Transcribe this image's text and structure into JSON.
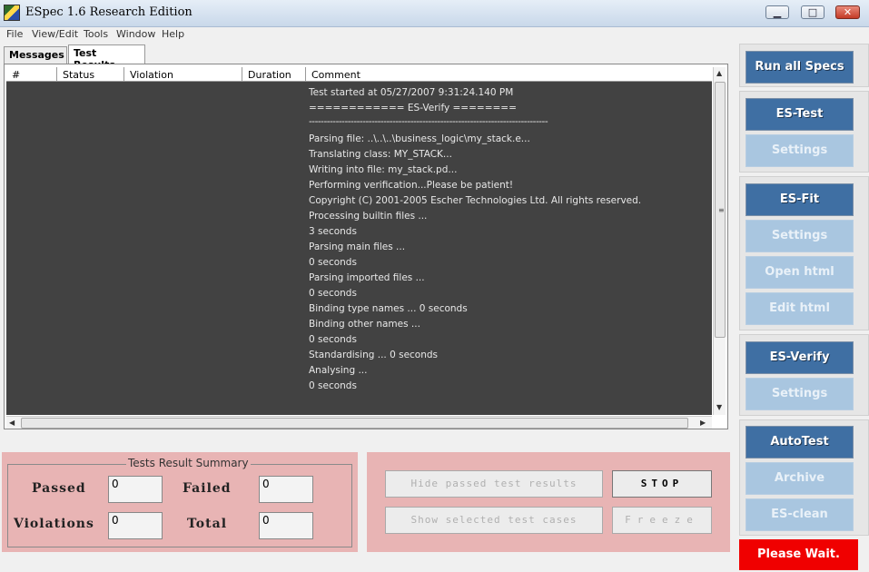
{
  "window": {
    "title": "ESpec 1.6 Research Edition"
  },
  "menu": [
    "File",
    "View/Edit",
    "Tools",
    "Window",
    "Help"
  ],
  "tabs": [
    "Messages",
    "Test Results"
  ],
  "table": {
    "columns": [
      "#",
      "Status",
      "Violation",
      "Duration",
      "Comment"
    ]
  },
  "log": [
    "Test started at 05/27/2007 9:31:24.140 PM",
    "============ ES-Verify ========",
    "--------------------------------------------------------------------------------",
    "Parsing file: ..\\..\\..\\business_logic\\my_stack.e...",
    " Translating class: MY_STACK...",
    " Writing into file: my_stack.pd...",
    "Performing verification...Please be patient!",
    "Copyright (C) 2001-2005 Escher Technologies Ltd. All rights reserved.",
    "Processing builtin files ...",
    "3 seconds",
    "Parsing main files ...",
    "0 seconds",
    "Parsing imported files ...",
    "0 seconds",
    "Binding type names ... 0 seconds",
    "Binding other names ...",
    "0 seconds",
    "Standardising ... 0 seconds",
    "Analysing ...",
    "0 seconds"
  ],
  "summary": {
    "title": "Tests Result Summary",
    "passed_label": "Passed",
    "passed": "0",
    "failed_label": "Failed",
    "failed": "0",
    "violations_label": "Violations",
    "violations": "0",
    "total_label": "Total",
    "total": "0"
  },
  "actions": {
    "hide_passed": "Hide passed test results",
    "stop": "STOP",
    "show_selected": "Show selected test cases",
    "freeze": "Freeze"
  },
  "sidebar": {
    "run_all": "Run all Specs",
    "es_test": "ES-Test",
    "es_test_settings": "Settings",
    "es_fit": "ES-Fit",
    "es_fit_settings": "Settings",
    "open_html": "Open html",
    "edit_html": "Edit html",
    "es_verify": "ES-Verify",
    "es_verify_settings": "Settings",
    "autotest": "AutoTest",
    "archive": "Archive",
    "es_clean": "ES-clean",
    "status": "Please Wait."
  }
}
